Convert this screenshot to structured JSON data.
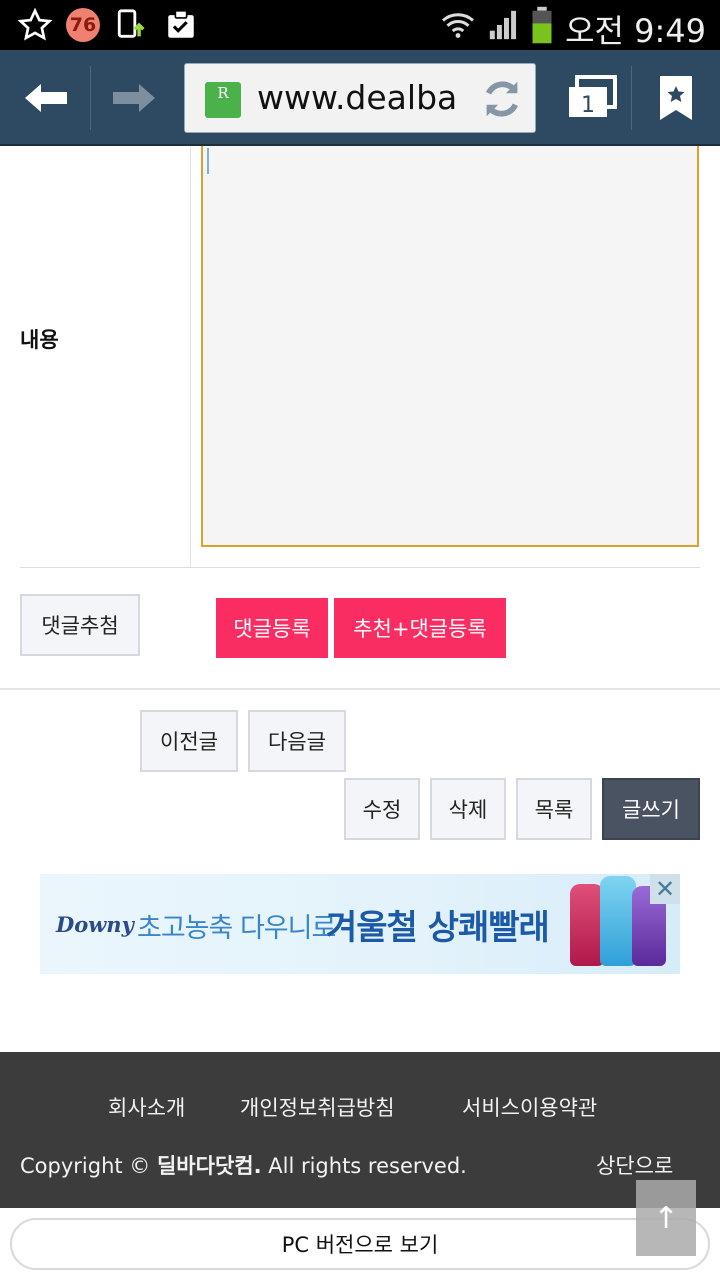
{
  "status_bar": {
    "notification_count": "76",
    "time": "오전 9:49",
    "icons": [
      "star-outline-icon",
      "badge-icon",
      "phone-upload-icon",
      "clipboard-check-icon",
      "wifi-icon",
      "signal-icon",
      "battery-icon"
    ]
  },
  "browser": {
    "url": "www.dealbada",
    "favicon_letter": "R",
    "tab_count": "1",
    "colors": {
      "bar": "#2e4a63"
    }
  },
  "form": {
    "content_label": "내용",
    "content_value": "",
    "comment_recommend_button": "댓글추첨",
    "comment_submit_button": "댓글등록",
    "recommend_comment_button": "추천+댓글등록"
  },
  "nav": {
    "prev_button": "이전글",
    "next_button": "다음글",
    "edit_button": "수정",
    "delete_button": "삭제",
    "list_button": "목록",
    "write_button": "글쓰기"
  },
  "ad": {
    "brand": "Downy",
    "text_small": "초고농축 다우니로",
    "text_big": "겨울철 상쾌빨래",
    "close_symbol": "✕"
  },
  "footer": {
    "links": [
      "회사소개",
      "개인정보취급방침",
      "서비스이용약관"
    ],
    "copyright_prefix": "Copyright ©",
    "copyright_brand": "딜바다닷컴.",
    "copyright_suffix": "All rights reserved.",
    "to_top": "상단으로",
    "pc_version": "PC 버전으로 보기",
    "scroll_top_symbol": "↑"
  },
  "colors": {
    "accent_pink": "#fa2d63",
    "dark_button": "#4a5361",
    "footer_bg": "#3c3c3c",
    "textarea_border": "#e0a030"
  }
}
